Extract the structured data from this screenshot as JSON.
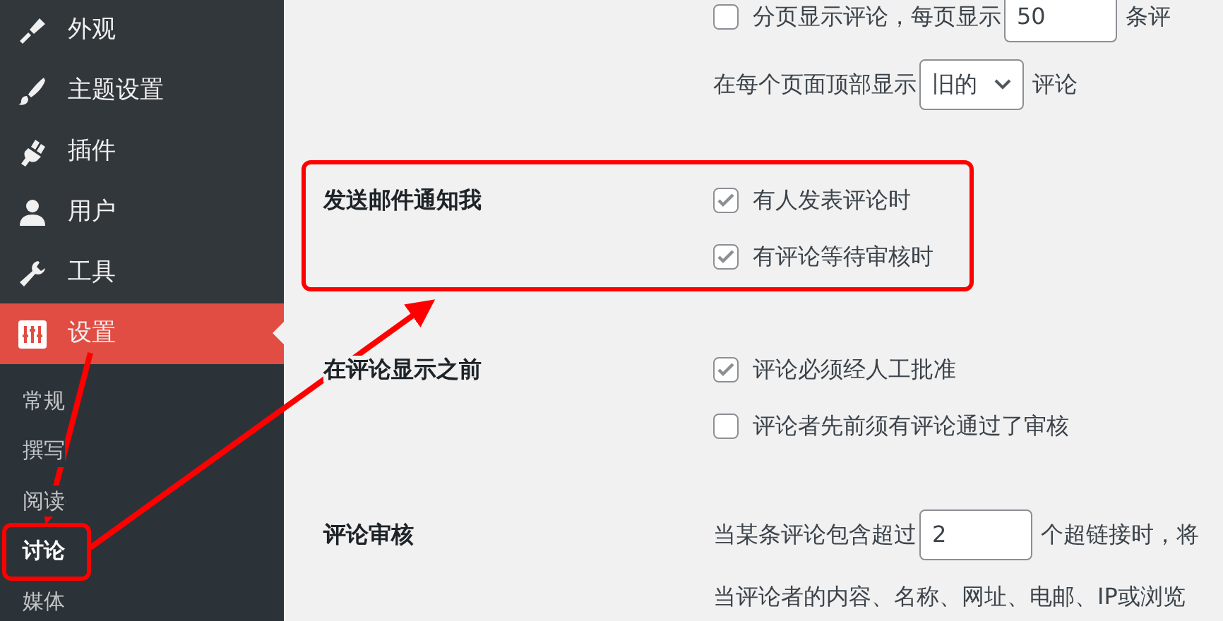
{
  "sidebar": {
    "items": [
      {
        "label": "外观",
        "selected": false
      },
      {
        "label": "主题设置",
        "selected": false
      },
      {
        "label": "插件",
        "selected": false
      },
      {
        "label": "用户",
        "selected": false
      },
      {
        "label": "工具",
        "selected": false
      },
      {
        "label": "设置",
        "selected": true
      }
    ],
    "submenu": [
      {
        "label": "常规",
        "selected": false
      },
      {
        "label": "撰写",
        "selected": false
      },
      {
        "label": "阅读",
        "selected": false
      },
      {
        "label": "讨论",
        "selected": true
      },
      {
        "label": "媒体",
        "selected": false
      }
    ]
  },
  "settings": [
    {
      "lines": [
        {
          "kind": "checkbox-input",
          "checked": false,
          "before": "分页显示评论，每页显示",
          "value": "50",
          "after": "条评"
        },
        {
          "kind": "select",
          "before": "在每个页面顶部显示",
          "value": "旧的",
          "after": "评论"
        }
      ]
    },
    {
      "label": "发送邮件通知我",
      "lines": [
        {
          "kind": "checkbox",
          "checked": true,
          "before": "有人发表评论时"
        },
        {
          "kind": "checkbox",
          "checked": true,
          "before": "有评论等待审核时"
        }
      ]
    },
    {
      "label": "在评论显示之前",
      "lines": [
        {
          "kind": "checkbox",
          "checked": true,
          "before": "评论必须经人工批准"
        },
        {
          "kind": "checkbox",
          "checked": false,
          "before": "评论者先前须有评论通过了审核"
        }
      ]
    },
    {
      "label": "评论审核",
      "lines": [
        {
          "kind": "input",
          "before": "当某条评论包含超过",
          "value": "2",
          "after": "个超链接时，将"
        },
        {
          "kind": "text",
          "before": "当评论者的内容、名称、网址、电邮、IP或浏览"
        }
      ]
    }
  ]
}
